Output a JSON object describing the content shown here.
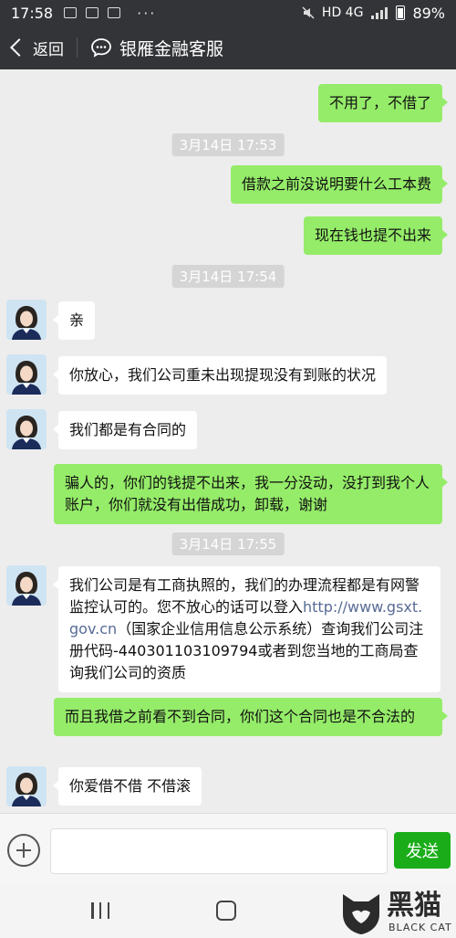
{
  "status_bar": {
    "time": "17:58",
    "network": "HD 4G",
    "battery": "89%"
  },
  "header": {
    "back_label": "返回",
    "title": "银雁金融客服"
  },
  "messages": [
    {
      "kind": "out",
      "text": "不用了，不借了"
    },
    {
      "kind": "time",
      "text": "3月14日 17:53"
    },
    {
      "kind": "out",
      "text": "借款之前没说明要什么工本费"
    },
    {
      "kind": "out",
      "text": "现在钱也提不出来"
    },
    {
      "kind": "time",
      "text": "3月14日 17:54"
    },
    {
      "kind": "in",
      "text": "亲"
    },
    {
      "kind": "in",
      "text": "你放心，我们公司重未出现提现没有到账的状况"
    },
    {
      "kind": "in",
      "text": "我们都是有合同的"
    },
    {
      "kind": "out",
      "text": "骗人的，你们的钱提不出来，我一分没动，没打到我个人账户，你们就没有出借成功，卸载，谢谢"
    },
    {
      "kind": "time",
      "text": "3月14日 17:55"
    },
    {
      "kind": "in",
      "text_before": "我们公司是有工商执照的，我们的办理流程都是有网警监控认可的。您不放心的话可以登入",
      "link": "http://www.gsxt.gov.cn",
      "text_after": "（国家企业信用信息公示系统）查询我们公司注册代码-440301103109794或者到您当地的工商局查询我们公司的资质"
    },
    {
      "kind": "out",
      "text": "而且我借之前看不到合同，你们这个合同也是不合法的"
    },
    {
      "kind": "in",
      "text": "你爱借不借  不借滚"
    }
  ],
  "input": {
    "send_label": "发送"
  },
  "watermark": {
    "title": "黑猫",
    "subtitle": "BLACK CAT"
  }
}
